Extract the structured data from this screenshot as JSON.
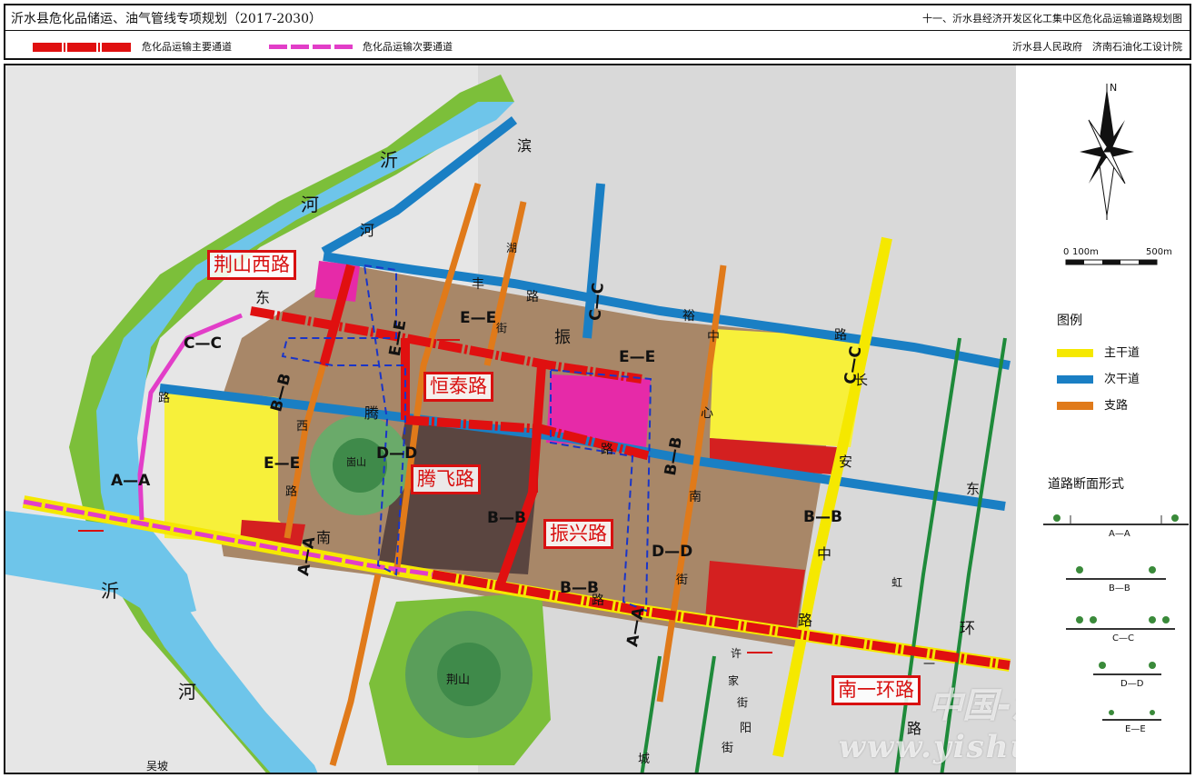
{
  "header": {
    "title": "沂水县危化品储运、油气管线专项规划（2017-2030）",
    "sheet_title": "十一、沂水县经济开发区化工集中区危化品运输道路规划图",
    "legend_main": "危化品运输主要通道",
    "legend_secondary": "危化品运输次要通道",
    "authors": "沂水县人民政府　济南石油化工设计院"
  },
  "map": {
    "place_labels": [
      "沂",
      "河",
      "河",
      "沂",
      "河",
      "崮山",
      "荆山",
      "吴坡",
      "滨",
      "东"
    ],
    "road_chars": [
      "丰",
      "路",
      "裕",
      "腾",
      "西",
      "路",
      "心",
      "中",
      "安",
      "长",
      "东",
      "南",
      "街",
      "路",
      "中",
      "环",
      "路",
      "振",
      "路",
      "路",
      "街",
      "城",
      "阳",
      "许",
      "湖",
      "路",
      "街",
      "家",
      "街",
      "路",
      "虹",
      "一",
      "南"
    ],
    "road_names": [
      "荆山西路",
      "恒泰路",
      "腾飞路",
      "振兴路",
      "南一环路"
    ],
    "section_labels": [
      "C—C",
      "B—B",
      "A—A",
      "E—E",
      "E—E",
      "E—E",
      "D—D",
      "C—C",
      "E—E",
      "B—B",
      "B—B",
      "B—B",
      "D—D",
      "A—A",
      "A—A",
      "C—C",
      "B—B"
    ],
    "watermark": "中国-沂水",
    "watermark_url": "www.yishui.gov.cn"
  },
  "legend": {
    "north": "N",
    "scale_0": "0",
    "scale_100": "100m",
    "scale_500": "500m",
    "title": "图例",
    "items": [
      {
        "label": "主干道",
        "color": "#f5e800"
      },
      {
        "label": "次干道",
        "color": "#1a7fc4"
      },
      {
        "label": "支路",
        "color": "#e07a1a"
      }
    ],
    "sections_title": "道路断面形式",
    "sections": [
      "A—A",
      "B—B",
      "C—C",
      "D—D",
      "E—E"
    ]
  },
  "colors": {
    "river": "#6ec5ea",
    "green": "#7cbf3a",
    "industrial": "#a88768",
    "dark_industrial": "#5a4540",
    "residential": "#f7f03a",
    "commercial": "#e62aa8",
    "red_block": "#d42020",
    "hill": "#3f8a4a",
    "main_route": "#e01010",
    "secondary_route": "#e23ec8"
  }
}
